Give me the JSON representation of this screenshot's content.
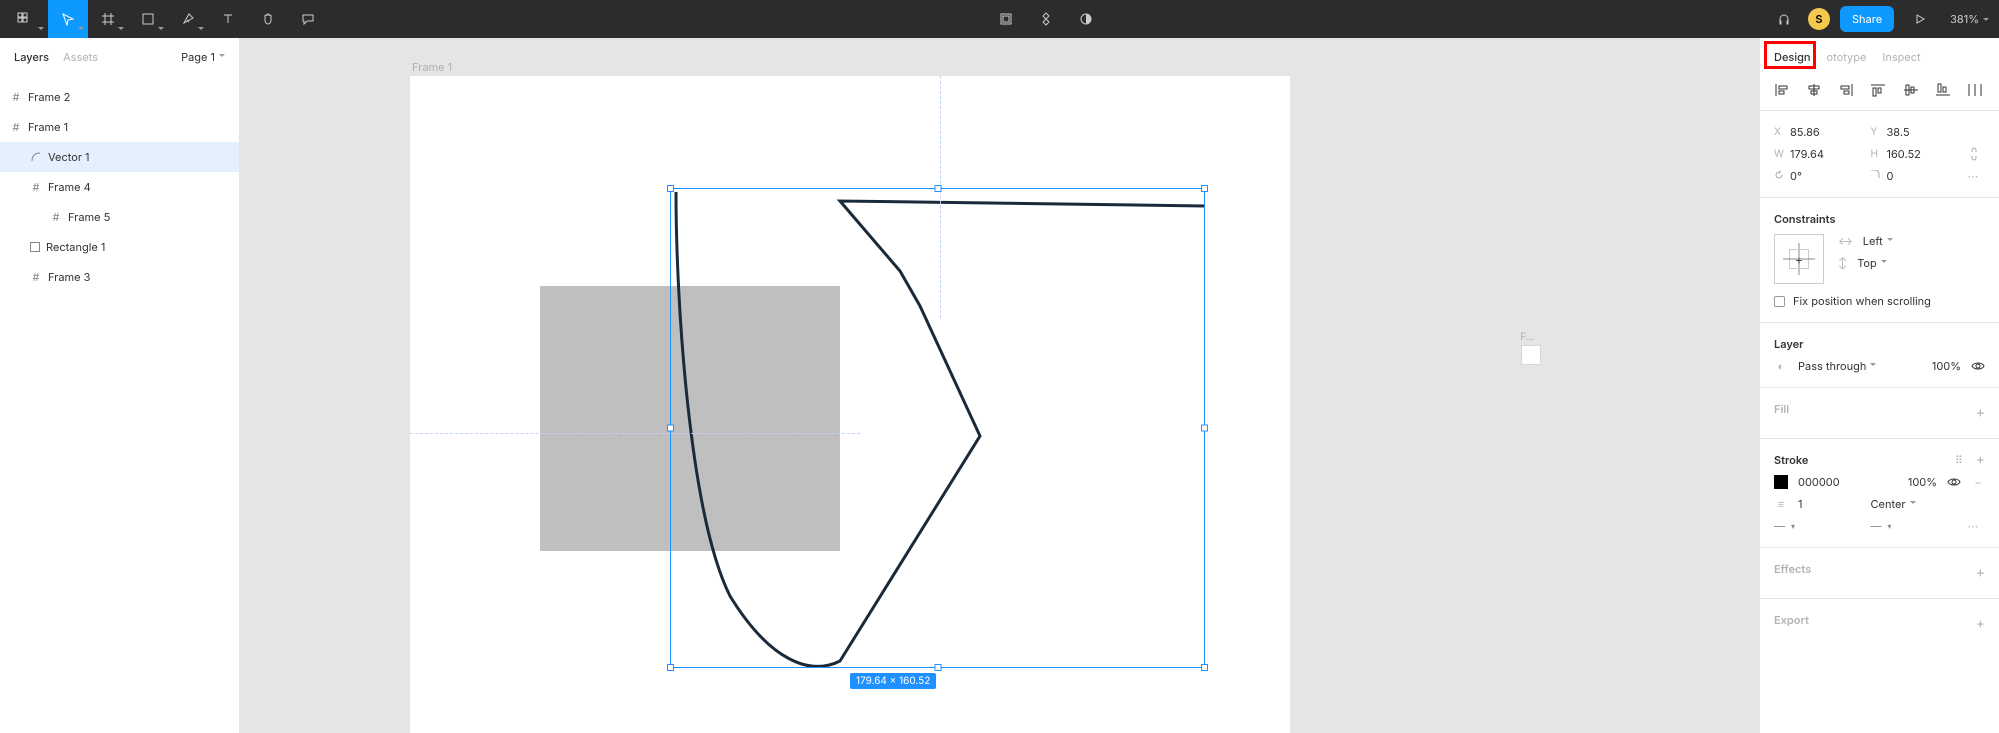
{
  "topbar": {
    "avatar_initial": "S",
    "share_label": "Share",
    "zoom": "381%"
  },
  "left": {
    "tabs": {
      "layers": "Layers",
      "assets": "Assets"
    },
    "page": "Page 1",
    "layers": [
      {
        "name": "Frame 2"
      },
      {
        "name": "Frame 1"
      },
      {
        "name": "Vector 1"
      },
      {
        "name": "Frame 4"
      },
      {
        "name": "Frame 5"
      },
      {
        "name": "Rectangle 1"
      },
      {
        "name": "Frame 3"
      }
    ]
  },
  "canvas": {
    "frame_label": "Frame 1",
    "dim_label": "179.64 × 160.52",
    "frame2_label": "F…"
  },
  "right": {
    "tabs": {
      "design": "Design",
      "prototype": "ototype",
      "inspect": "Inspect"
    },
    "x": "85.86",
    "y": "38.5",
    "w": "179.64",
    "h": "160.52",
    "rotation": "0°",
    "radius": "0",
    "constraints": {
      "title": "Constraints",
      "h": "Left",
      "v": "Top",
      "fix_label": "Fix position when scrolling"
    },
    "layer": {
      "title": "Layer",
      "blend": "Pass through",
      "opacity": "100%"
    },
    "fill": {
      "title": "Fill"
    },
    "stroke": {
      "title": "Stroke",
      "hex": "000000",
      "opacity": "100%",
      "weight": "1",
      "align": "Center"
    },
    "effects": {
      "title": "Effects"
    },
    "export": {
      "title": "Export"
    }
  }
}
